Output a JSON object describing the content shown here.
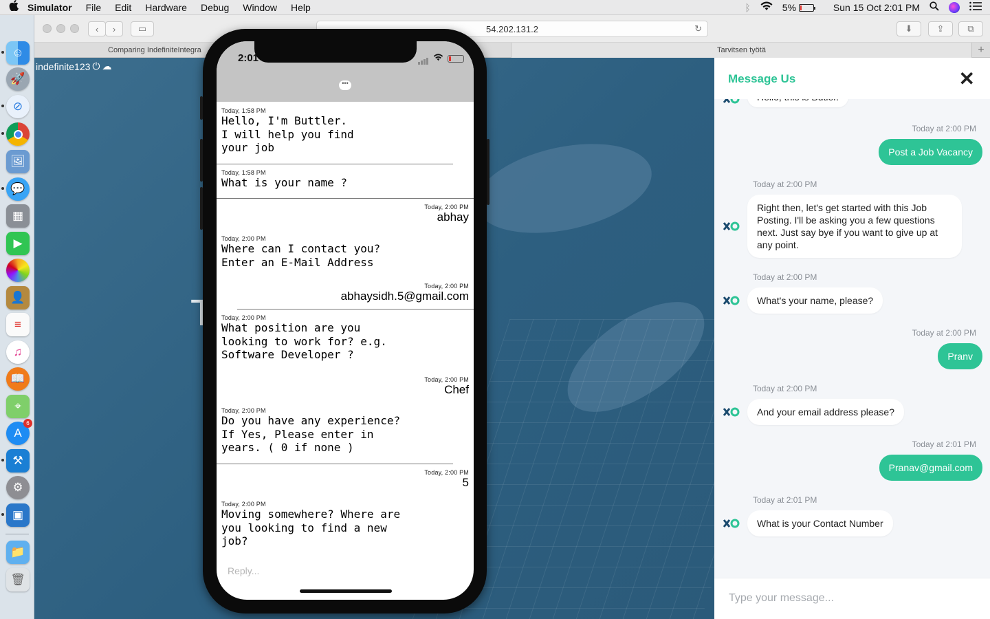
{
  "menubar": {
    "app_name": "Simulator",
    "menus": [
      "File",
      "Edit",
      "Hardware",
      "Debug",
      "Window",
      "Help"
    ],
    "battery_pct": "5%",
    "clock": "Sun 15 Oct  2:01 PM"
  },
  "browser": {
    "url": "54.202.131.2",
    "tabs": [
      "Comparing IndefiniteIntegra",
      "Tarvitsen työtä"
    ],
    "page_user": "indefinite123"
  },
  "message_us": {
    "title": "Message Us",
    "close": "✕",
    "partial_top": "Hello, this is Butler.",
    "messages": [
      {
        "side": "out",
        "ts": "Today at 2:00 PM",
        "text": "Post a Job Vacancy"
      },
      {
        "side": "in",
        "ts": "Today at 2:00 PM",
        "text": "Right then, let's get started with this Job Posting. I'll be asking you a few questions next. Just say bye if you want to give up at any point."
      },
      {
        "side": "in",
        "ts": "Today at 2:00 PM",
        "text": "What's your name, please?"
      },
      {
        "side": "out",
        "ts": "Today at 2:00 PM",
        "text": "Pranv"
      },
      {
        "side": "in",
        "ts": "Today at 2:00 PM",
        "text": "And your email address please?"
      },
      {
        "side": "out",
        "ts": "Today at 2:01 PM",
        "text": "Pranav@gmail.com"
      },
      {
        "side": "in",
        "ts": "Today at 2:01 PM",
        "text": "What is your Contact Number"
      }
    ],
    "input_placeholder": "Type your message..."
  },
  "phone": {
    "time": "2:01",
    "messages": [
      {
        "side": "bot",
        "ts": "Today, 1:58 PM",
        "text": "Hello, I'm Buttler.\n I will help you find\nyour job"
      },
      {
        "side": "bot",
        "ts": "Today, 1:58 PM",
        "text": "What is your name ?"
      },
      {
        "side": "user",
        "ts": "Today, 2:00 PM",
        "text": "abhay"
      },
      {
        "side": "bot",
        "ts": "Today, 2:00 PM",
        "text": "Where can I contact you?\nEnter an E-Mail Address"
      },
      {
        "side": "user",
        "ts": "Today, 2:00 PM",
        "text": "abhaysidh.5@gmail.com"
      },
      {
        "side": "bot",
        "ts": "Today, 2:00 PM",
        "text": "What position are you\nlooking to work for? e.g.\nSoftware Developer ?"
      },
      {
        "side": "user",
        "ts": "Today, 2:00 PM",
        "text": "Chef"
      },
      {
        "side": "bot",
        "ts": "Today, 2:00 PM",
        "text": "Do you have any experience?\nIf Yes, Please enter in\nyears. ( 0 if none )"
      },
      {
        "side": "user",
        "ts": "Today, 2:00 PM",
        "text": "5"
      },
      {
        "side": "bot",
        "ts": "Today, 2:00 PM",
        "text": "Moving somewhere? Where are\nyou looking to find a new\njob?"
      }
    ],
    "reply_placeholder": "Reply..."
  },
  "dock": {
    "icons": [
      "finder-icon",
      "launchpad-icon",
      "safari-icon",
      "chrome-icon",
      "preview-icon",
      "messages-icon",
      "calculator-icon",
      "facetime-icon",
      "photos-icon",
      "contacts-icon",
      "reminders-icon",
      "itunes-icon",
      "ibooks-icon",
      "maps-icon",
      "app-store-icon",
      "xcode-icon",
      "system-preferences-icon",
      "simulator-icon",
      "downloads-folder-icon",
      "trash-icon"
    ],
    "app_store_badge": "6"
  }
}
